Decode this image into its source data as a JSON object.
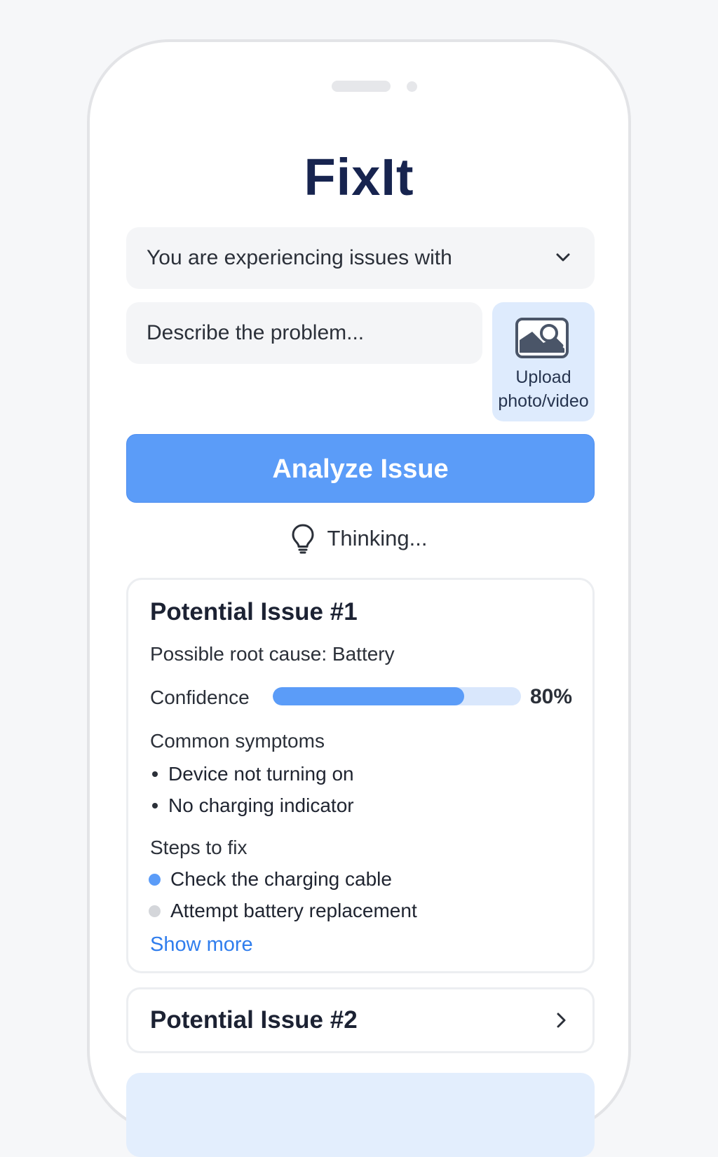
{
  "app": {
    "title": "FixIt"
  },
  "issue_select": {
    "value": "You are experiencing issues with"
  },
  "description": {
    "placeholder": "Describe the problem..."
  },
  "upload": {
    "label_line1": "Upload",
    "label_line2": "photo/video",
    "icon": "image-icon"
  },
  "analyze_button": {
    "label": "Analyze Issue"
  },
  "status": {
    "text": "Thinking...",
    "icon": "lightbulb-icon"
  },
  "results": [
    {
      "title": "Potential Issue #1",
      "root_cause": "Possible root cause: Battery",
      "confidence_label": "Confidence",
      "confidence_value": "80%",
      "confidence_fraction": 0.77,
      "symptoms_label": "Common symptoms",
      "symptoms": [
        "Device not turning on",
        "No charging indicator"
      ],
      "steps_label": "Steps to fix",
      "steps": [
        {
          "text": "Check the charging cable",
          "status_color": "#5b9cf8"
        },
        {
          "text": "Attempt battery replacement",
          "status_color": "#d4d6da"
        }
      ],
      "show_more": "Show more"
    },
    {
      "title": "Potential Issue #2"
    }
  ],
  "colors": {
    "accent": "#5b9cf8",
    "title": "#17244f",
    "link": "#2f7ded"
  }
}
